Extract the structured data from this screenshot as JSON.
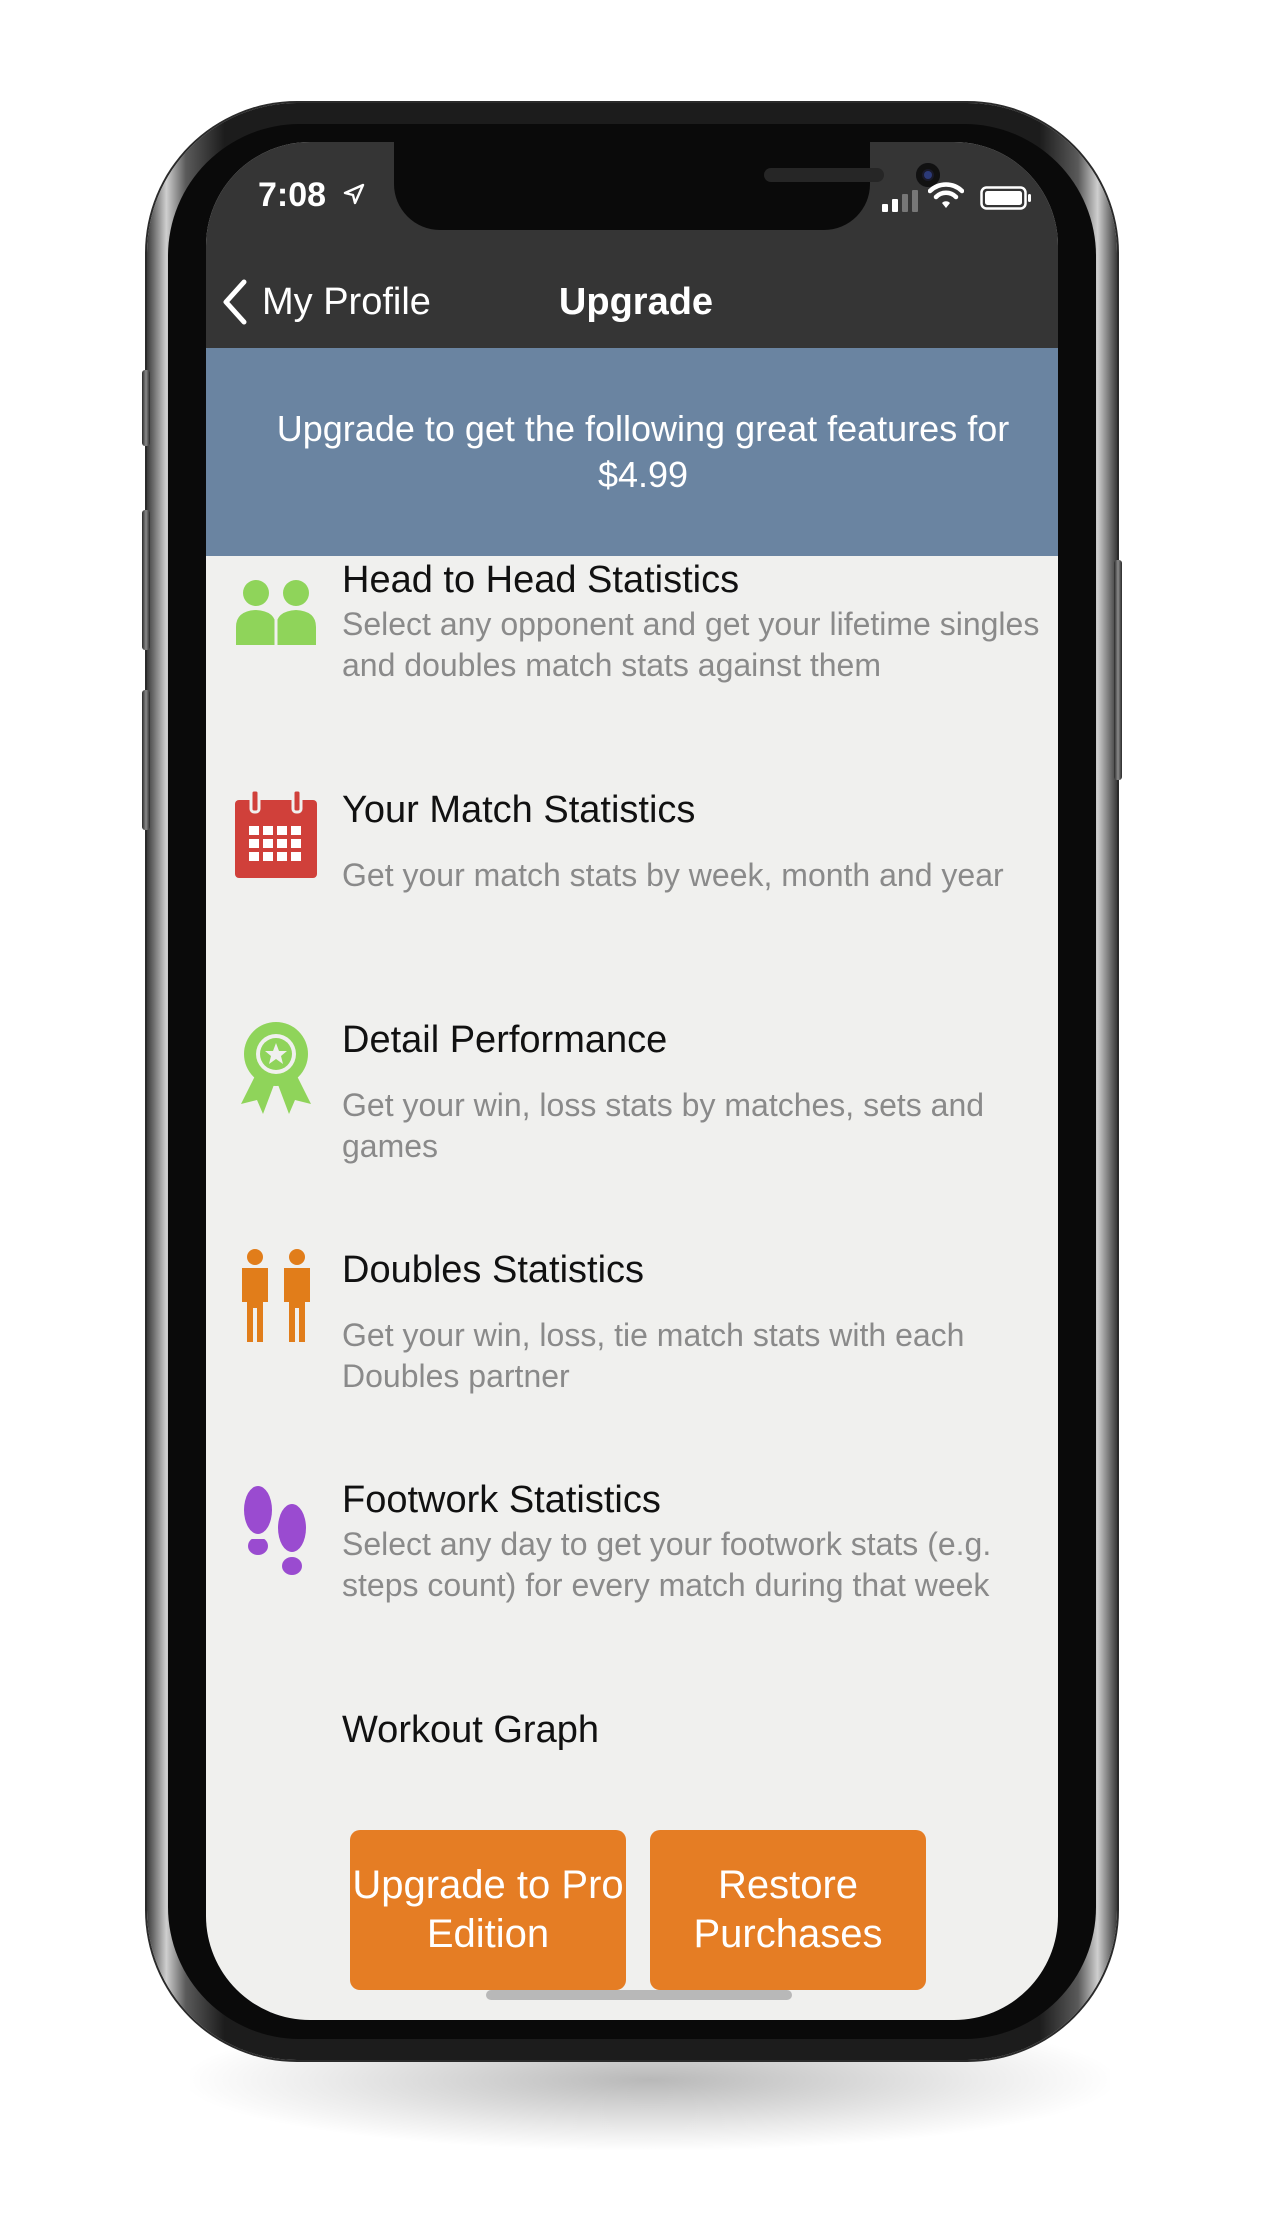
{
  "status_bar": {
    "time": "7:08",
    "icons": [
      "location-arrow-icon",
      "cellular-signal-icon",
      "wifi-icon",
      "battery-icon"
    ]
  },
  "nav": {
    "back_label": "My Profile",
    "title": "Upgrade"
  },
  "banner": {
    "text": "Upgrade to get the following great features for $4.99"
  },
  "features": [
    {
      "title": "Head to Head Statistics",
      "description": "Select any opponent and get your lifetime singles and doubles match stats against them",
      "icon": "two-people-icon",
      "icon_color": "#8fd45a"
    },
    {
      "title": "Your Match Statistics",
      "description": "Get your match stats by week, month and year",
      "icon": "calendar-icon",
      "icon_color": "#d0403a"
    },
    {
      "title": "Detail Performance",
      "description": "Get your win, loss stats by matches, sets and games",
      "icon": "award-ribbon-icon",
      "icon_color": "#8fd45a"
    },
    {
      "title": "Doubles Statistics",
      "description": "Get your win, loss, tie match stats with each Doubles partner",
      "icon": "doubles-partners-icon",
      "icon_color": "#e17d1a"
    },
    {
      "title": "Footwork Statistics",
      "description": "Select any day to get your footwork stats (e.g. steps count) for every match during that week",
      "icon": "footprints-icon",
      "icon_color": "#9a4bd0"
    },
    {
      "title": "Workout Graph",
      "description": "",
      "icon": "workout-graph-icon",
      "icon_color": "#2a7fd0"
    }
  ],
  "buttons": {
    "upgrade": "Upgrade to Pro Edition",
    "restore": "Restore Purchases"
  },
  "colors": {
    "nav_bar": "#353535",
    "banner": "#6a84a1",
    "background": "#f0f0ee",
    "accent": "#e57d24"
  }
}
